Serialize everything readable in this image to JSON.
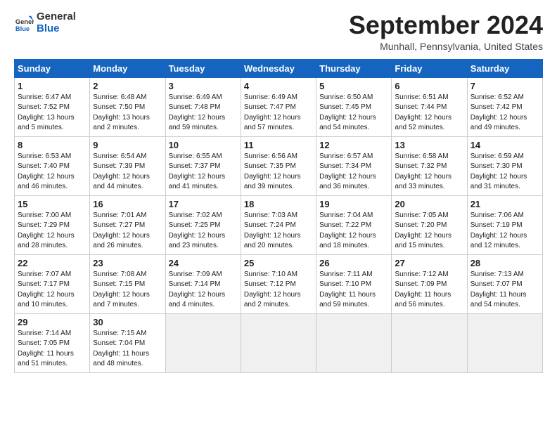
{
  "header": {
    "logo_line1": "General",
    "logo_line2": "Blue",
    "month_title": "September 2024",
    "location": "Munhall, Pennsylvania, United States"
  },
  "calendar": {
    "days_of_week": [
      "Sunday",
      "Monday",
      "Tuesday",
      "Wednesday",
      "Thursday",
      "Friday",
      "Saturday"
    ],
    "weeks": [
      [
        {
          "day": "1",
          "sunrise": "6:47 AM",
          "sunset": "7:52 PM",
          "daylight": "13 hours and 5 minutes."
        },
        {
          "day": "2",
          "sunrise": "6:48 AM",
          "sunset": "7:50 PM",
          "daylight": "13 hours and 2 minutes."
        },
        {
          "day": "3",
          "sunrise": "6:49 AM",
          "sunset": "7:48 PM",
          "daylight": "12 hours and 59 minutes."
        },
        {
          "day": "4",
          "sunrise": "6:49 AM",
          "sunset": "7:47 PM",
          "daylight": "12 hours and 57 minutes."
        },
        {
          "day": "5",
          "sunrise": "6:50 AM",
          "sunset": "7:45 PM",
          "daylight": "12 hours and 54 minutes."
        },
        {
          "day": "6",
          "sunrise": "6:51 AM",
          "sunset": "7:44 PM",
          "daylight": "12 hours and 52 minutes."
        },
        {
          "day": "7",
          "sunrise": "6:52 AM",
          "sunset": "7:42 PM",
          "daylight": "12 hours and 49 minutes."
        }
      ],
      [
        {
          "day": "8",
          "sunrise": "6:53 AM",
          "sunset": "7:40 PM",
          "daylight": "12 hours and 46 minutes."
        },
        {
          "day": "9",
          "sunrise": "6:54 AM",
          "sunset": "7:39 PM",
          "daylight": "12 hours and 44 minutes."
        },
        {
          "day": "10",
          "sunrise": "6:55 AM",
          "sunset": "7:37 PM",
          "daylight": "12 hours and 41 minutes."
        },
        {
          "day": "11",
          "sunrise": "6:56 AM",
          "sunset": "7:35 PM",
          "daylight": "12 hours and 39 minutes."
        },
        {
          "day": "12",
          "sunrise": "6:57 AM",
          "sunset": "7:34 PM",
          "daylight": "12 hours and 36 minutes."
        },
        {
          "day": "13",
          "sunrise": "6:58 AM",
          "sunset": "7:32 PM",
          "daylight": "12 hours and 33 minutes."
        },
        {
          "day": "14",
          "sunrise": "6:59 AM",
          "sunset": "7:30 PM",
          "daylight": "12 hours and 31 minutes."
        }
      ],
      [
        {
          "day": "15",
          "sunrise": "7:00 AM",
          "sunset": "7:29 PM",
          "daylight": "12 hours and 28 minutes."
        },
        {
          "day": "16",
          "sunrise": "7:01 AM",
          "sunset": "7:27 PM",
          "daylight": "12 hours and 26 minutes."
        },
        {
          "day": "17",
          "sunrise": "7:02 AM",
          "sunset": "7:25 PM",
          "daylight": "12 hours and 23 minutes."
        },
        {
          "day": "18",
          "sunrise": "7:03 AM",
          "sunset": "7:24 PM",
          "daylight": "12 hours and 20 minutes."
        },
        {
          "day": "19",
          "sunrise": "7:04 AM",
          "sunset": "7:22 PM",
          "daylight": "12 hours and 18 minutes."
        },
        {
          "day": "20",
          "sunrise": "7:05 AM",
          "sunset": "7:20 PM",
          "daylight": "12 hours and 15 minutes."
        },
        {
          "day": "21",
          "sunrise": "7:06 AM",
          "sunset": "7:19 PM",
          "daylight": "12 hours and 12 minutes."
        }
      ],
      [
        {
          "day": "22",
          "sunrise": "7:07 AM",
          "sunset": "7:17 PM",
          "daylight": "12 hours and 10 minutes."
        },
        {
          "day": "23",
          "sunrise": "7:08 AM",
          "sunset": "7:15 PM",
          "daylight": "12 hours and 7 minutes."
        },
        {
          "day": "24",
          "sunrise": "7:09 AM",
          "sunset": "7:14 PM",
          "daylight": "12 hours and 4 minutes."
        },
        {
          "day": "25",
          "sunrise": "7:10 AM",
          "sunset": "7:12 PM",
          "daylight": "12 hours and 2 minutes."
        },
        {
          "day": "26",
          "sunrise": "7:11 AM",
          "sunset": "7:10 PM",
          "daylight": "11 hours and 59 minutes."
        },
        {
          "day": "27",
          "sunrise": "7:12 AM",
          "sunset": "7:09 PM",
          "daylight": "11 hours and 56 minutes."
        },
        {
          "day": "28",
          "sunrise": "7:13 AM",
          "sunset": "7:07 PM",
          "daylight": "11 hours and 54 minutes."
        }
      ],
      [
        {
          "day": "29",
          "sunrise": "7:14 AM",
          "sunset": "7:05 PM",
          "daylight": "11 hours and 51 minutes."
        },
        {
          "day": "30",
          "sunrise": "7:15 AM",
          "sunset": "7:04 PM",
          "daylight": "11 hours and 48 minutes."
        },
        null,
        null,
        null,
        null,
        null
      ]
    ]
  }
}
